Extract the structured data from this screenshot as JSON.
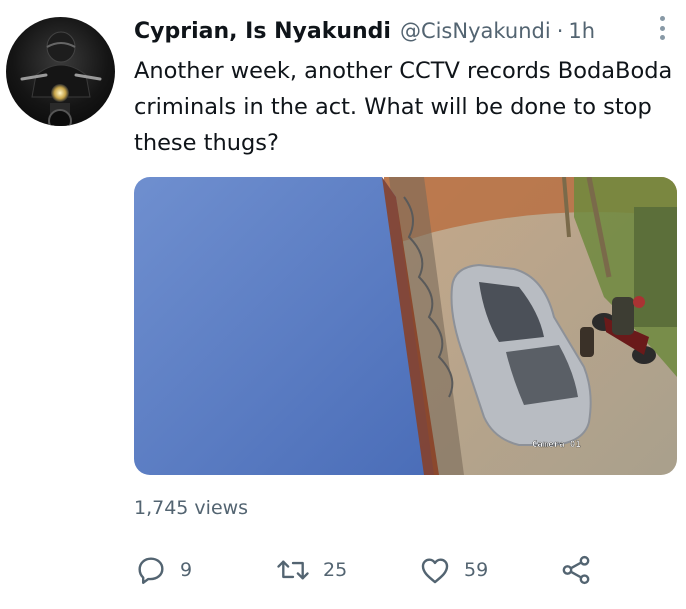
{
  "tweet": {
    "author_name": "Cyprian, Is Nyakundi",
    "author_handle": "@CisNyakundi",
    "separator": "·",
    "timestamp": "1h",
    "text": "Another week, another CCTV records BodaBoda criminals in the act. What will be done to stop these thugs?",
    "media_overlay_text": "Camera 01",
    "views": "1,745 views"
  },
  "actions": {
    "reply_count": "9",
    "retweet_count": "25",
    "like_count": "59"
  },
  "icons": {
    "reply": "reply-icon",
    "retweet": "retweet-icon",
    "like": "heart-icon",
    "share": "share-icon",
    "more": "more-options-icon"
  },
  "colors": {
    "text_primary": "#0f1419",
    "text_secondary": "#536471"
  }
}
